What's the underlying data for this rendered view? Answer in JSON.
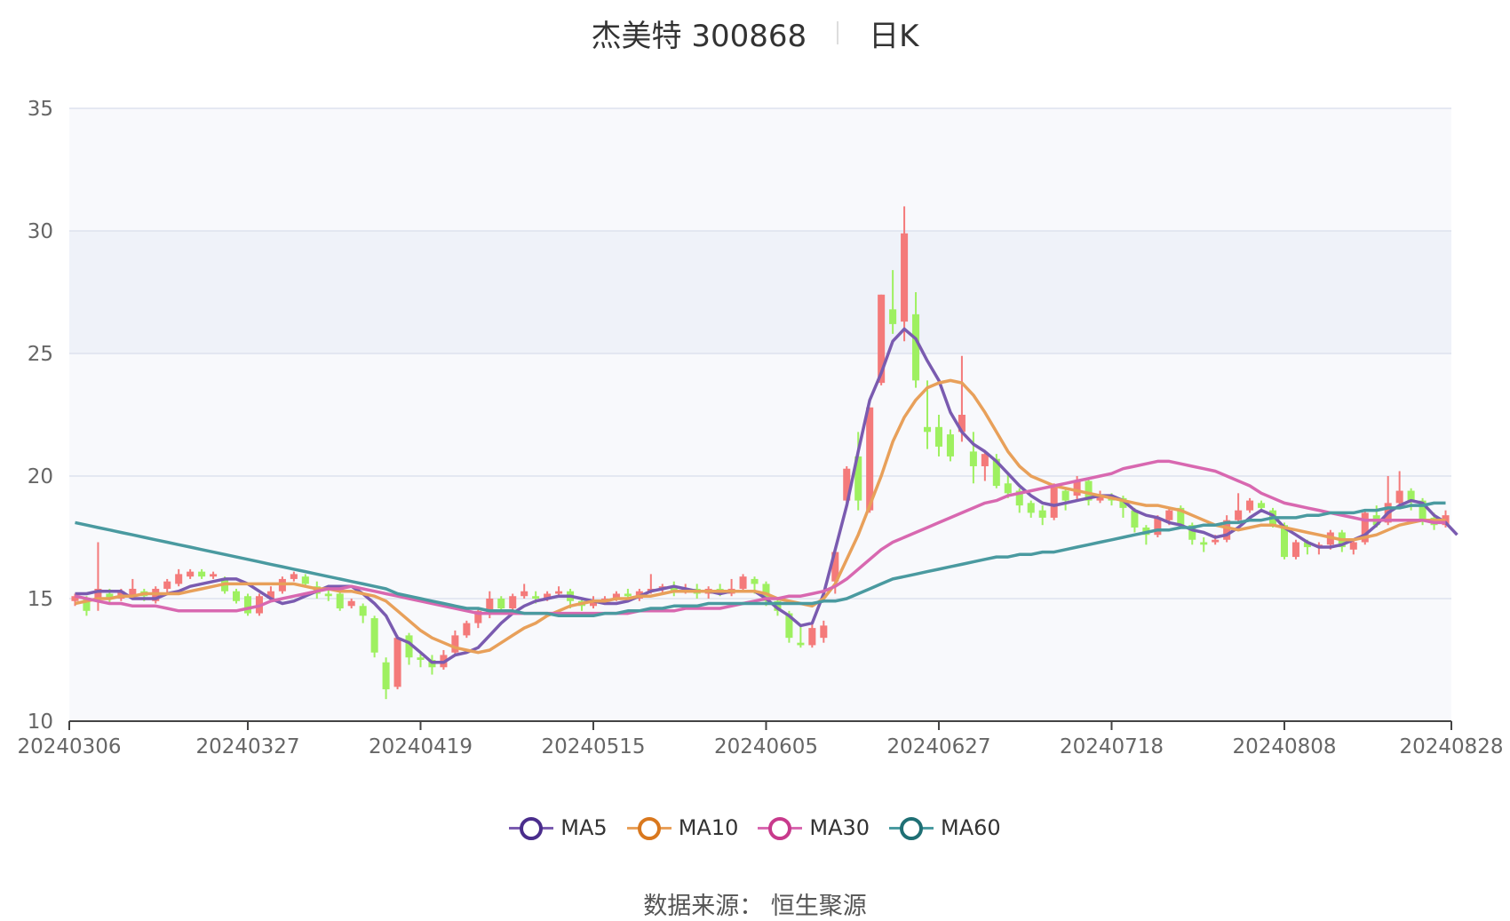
{
  "header": {
    "title": "杰美特 300868",
    "period": "日K"
  },
  "source": "数据来源： 恒生聚源",
  "colors": {
    "up": "#f47a7a",
    "down": "#9ef060",
    "MA5": "#7a5bb0",
    "MA10": "#e8a05a",
    "MA30": "#d868b0",
    "MA60": "#4a9aa0",
    "legend_ring": {
      "MA5": "#4a2d8c",
      "MA10": "#d9781e",
      "MA30": "#c83a8c",
      "MA60": "#1f6f74"
    }
  },
  "chart_data": {
    "type": "candlestick",
    "title": "杰美特 300868",
    "subtitle": "日K",
    "ylim": [
      10,
      35
    ],
    "y_ticks": [
      10,
      15,
      20,
      25,
      30,
      35
    ],
    "x_tick_labels": [
      "20240306",
      "20240327",
      "20240419",
      "20240515",
      "20240605",
      "20240627",
      "20240718",
      "20240808",
      "20240828"
    ],
    "x_tick_index": [
      0,
      15,
      30,
      45,
      60,
      75,
      90,
      105,
      119
    ],
    "grid": true,
    "legend_position": "bottom",
    "legend": [
      "MA5",
      "MA10",
      "MA30",
      "MA60"
    ],
    "candles": [
      [
        14.9,
        15.1,
        15.2,
        14.7
      ],
      [
        15.0,
        14.5,
        15.1,
        14.3
      ],
      [
        15.0,
        15.4,
        17.3,
        14.5
      ],
      [
        15.2,
        15.0,
        15.4,
        14.8
      ],
      [
        15.0,
        15.3,
        15.4,
        14.9
      ],
      [
        15.1,
        15.4,
        15.8,
        15.0
      ],
      [
        15.3,
        15.1,
        15.4,
        14.9
      ],
      [
        14.9,
        15.4,
        15.5,
        14.8
      ],
      [
        15.4,
        15.7,
        15.8,
        15.2
      ],
      [
        15.6,
        16.0,
        16.2,
        15.5
      ],
      [
        15.9,
        16.1,
        16.2,
        15.8
      ],
      [
        16.1,
        15.9,
        16.2,
        15.8
      ],
      [
        15.9,
        16.0,
        16.1,
        15.8
      ],
      [
        15.8,
        15.3,
        15.9,
        15.2
      ],
      [
        15.3,
        14.9,
        15.4,
        14.8
      ],
      [
        15.1,
        14.4,
        15.2,
        14.3
      ],
      [
        14.4,
        15.1,
        15.2,
        14.3
      ],
      [
        15.0,
        15.3,
        15.5,
        14.9
      ],
      [
        15.3,
        15.8,
        15.9,
        15.2
      ],
      [
        15.8,
        16.0,
        16.1,
        15.7
      ],
      [
        15.9,
        15.6,
        16.0,
        15.5
      ],
      [
        15.5,
        15.2,
        15.7,
        15.0
      ],
      [
        15.2,
        15.1,
        15.4,
        14.9
      ],
      [
        15.2,
        14.6,
        15.3,
        14.5
      ],
      [
        14.7,
        14.9,
        15.0,
        14.6
      ],
      [
        14.7,
        14.3,
        14.8,
        14.0
      ],
      [
        14.2,
        12.8,
        14.3,
        12.6
      ],
      [
        12.4,
        11.3,
        12.6,
        10.9
      ],
      [
        11.4,
        13.4,
        13.5,
        11.3
      ],
      [
        13.5,
        12.6,
        13.6,
        12.3
      ],
      [
        12.6,
        12.5,
        12.8,
        12.2
      ],
      [
        12.5,
        12.2,
        12.7,
        11.9
      ],
      [
        12.2,
        12.7,
        12.9,
        12.1
      ],
      [
        12.8,
        13.5,
        13.7,
        12.7
      ],
      [
        13.5,
        14.0,
        14.1,
        13.4
      ],
      [
        14.0,
        14.5,
        14.6,
        13.8
      ],
      [
        14.4,
        15.0,
        15.3,
        14.2
      ],
      [
        15.0,
        14.6,
        15.1,
        14.4
      ],
      [
        14.6,
        15.1,
        15.2,
        14.5
      ],
      [
        15.1,
        15.3,
        15.6,
        15.0
      ],
      [
        15.1,
        15.0,
        15.3,
        14.8
      ],
      [
        15.0,
        15.2,
        15.3,
        14.9
      ],
      [
        15.2,
        15.3,
        15.5,
        15.1
      ],
      [
        15.3,
        14.9,
        15.4,
        14.6
      ],
      [
        14.9,
        14.7,
        15.0,
        14.5
      ],
      [
        14.7,
        14.9,
        15.1,
        14.6
      ],
      [
        14.9,
        15.0,
        15.1,
        14.8
      ],
      [
        15.0,
        15.2,
        15.3,
        14.9
      ],
      [
        15.2,
        15.1,
        15.4,
        15.0
      ],
      [
        15.0,
        15.3,
        15.4,
        14.9
      ],
      [
        15.3,
        15.4,
        16.0,
        15.2
      ],
      [
        15.4,
        15.5,
        15.6,
        15.2
      ],
      [
        15.5,
        15.3,
        15.7,
        15.1
      ],
      [
        15.3,
        15.4,
        15.6,
        15.2
      ],
      [
        15.4,
        15.2,
        15.6,
        15.0
      ],
      [
        15.2,
        15.4,
        15.5,
        15.0
      ],
      [
        15.4,
        15.2,
        15.6,
        15.1
      ],
      [
        15.2,
        15.4,
        15.8,
        15.1
      ],
      [
        15.4,
        15.9,
        16.0,
        15.3
      ],
      [
        15.8,
        15.6,
        15.9,
        15.2
      ],
      [
        15.6,
        14.9,
        15.7,
        14.7
      ],
      [
        14.9,
        14.5,
        15.0,
        14.3
      ],
      [
        14.4,
        13.4,
        14.5,
        13.2
      ],
      [
        13.2,
        13.1,
        13.9,
        13.0
      ],
      [
        13.1,
        13.8,
        14.0,
        13.0
      ],
      [
        13.4,
        13.9,
        14.1,
        13.2
      ],
      [
        15.7,
        16.9,
        17.0,
        15.2
      ],
      [
        19.0,
        20.3,
        20.4,
        18.9
      ],
      [
        20.8,
        19.0,
        21.8,
        18.6
      ],
      [
        18.6,
        22.8,
        22.8,
        18.5
      ],
      [
        23.8,
        27.4,
        27.4,
        23.7
      ],
      [
        26.8,
        26.2,
        28.4,
        25.8
      ],
      [
        26.3,
        29.9,
        31.0,
        25.5
      ],
      [
        26.6,
        23.9,
        27.5,
        23.6
      ],
      [
        22.0,
        21.8,
        23.9,
        21.1
      ],
      [
        22.0,
        21.2,
        22.5,
        20.8
      ],
      [
        21.7,
        20.8,
        21.9,
        20.6
      ],
      [
        21.8,
        22.5,
        24.9,
        21.4
      ],
      [
        21.0,
        20.4,
        21.8,
        19.7
      ],
      [
        20.4,
        20.9,
        21.0,
        19.8
      ],
      [
        20.7,
        19.6,
        20.9,
        19.5
      ],
      [
        19.7,
        19.3,
        20.1,
        19.1
      ],
      [
        19.4,
        18.8,
        19.5,
        18.5
      ],
      [
        18.9,
        18.5,
        19.0,
        18.3
      ],
      [
        18.6,
        18.3,
        18.8,
        18.0
      ],
      [
        18.3,
        19.6,
        19.7,
        18.2
      ],
      [
        19.4,
        19.0,
        19.5,
        18.6
      ],
      [
        19.2,
        19.8,
        20.0,
        19.0
      ],
      [
        19.8,
        19.0,
        19.9,
        18.8
      ],
      [
        19.0,
        19.2,
        19.4,
        18.9
      ],
      [
        19.1,
        19.0,
        19.3,
        18.8
      ],
      [
        19.1,
        18.7,
        19.2,
        18.3
      ],
      [
        18.6,
        17.9,
        18.7,
        17.7
      ],
      [
        17.9,
        17.6,
        18.0,
        17.2
      ],
      [
        17.6,
        18.3,
        18.4,
        17.5
      ],
      [
        18.2,
        18.6,
        18.7,
        18.0
      ],
      [
        18.7,
        18.0,
        18.8,
        17.9
      ],
      [
        18.0,
        17.4,
        18.1,
        17.2
      ],
      [
        17.3,
        17.2,
        17.5,
        16.9
      ],
      [
        17.3,
        17.4,
        17.6,
        17.2
      ],
      [
        17.4,
        18.2,
        18.4,
        17.3
      ],
      [
        18.2,
        18.6,
        19.3,
        18.1
      ],
      [
        18.6,
        19.0,
        19.1,
        18.5
      ],
      [
        18.9,
        18.7,
        19.0,
        18.6
      ],
      [
        18.6,
        18.0,
        18.7,
        17.9
      ],
      [
        18.0,
        16.7,
        18.1,
        16.6
      ],
      [
        16.7,
        17.3,
        17.4,
        16.6
      ],
      [
        17.3,
        17.1,
        17.4,
        16.8
      ],
      [
        17.1,
        17.2,
        17.3,
        16.8
      ],
      [
        17.2,
        17.7,
        17.8,
        17.0
      ],
      [
        17.7,
        17.1,
        17.8,
        16.9
      ],
      [
        17.0,
        17.3,
        17.4,
        16.8
      ],
      [
        17.3,
        18.5,
        18.6,
        17.2
      ],
      [
        18.4,
        18.0,
        18.8,
        17.9
      ],
      [
        18.1,
        18.9,
        20.0,
        18.0
      ],
      [
        18.9,
        19.4,
        20.2,
        18.8
      ],
      [
        19.4,
        19.0,
        19.5,
        18.6
      ],
      [
        19.0,
        18.2,
        19.1,
        18.0
      ],
      [
        18.3,
        18.0,
        18.5,
        17.8
      ],
      [
        18.0,
        18.4,
        18.6,
        17.9
      ]
    ],
    "series": [
      {
        "name": "MA5",
        "values": [
          15.2,
          15.2,
          15.3,
          15.3,
          15.3,
          15.0,
          15.0,
          15.0,
          15.2,
          15.3,
          15.5,
          15.6,
          15.7,
          15.8,
          15.8,
          15.6,
          15.3,
          15.0,
          14.8,
          14.9,
          15.1,
          15.3,
          15.5,
          15.5,
          15.5,
          15.2,
          14.8,
          14.3,
          13.4,
          13.2,
          12.8,
          12.4,
          12.4,
          12.7,
          12.8,
          13.0,
          13.5,
          14.0,
          14.4,
          14.7,
          14.9,
          15.0,
          15.1,
          15.1,
          15.0,
          14.9,
          14.8,
          14.8,
          14.9,
          15.1,
          15.3,
          15.4,
          15.5,
          15.4,
          15.3,
          15.3,
          15.2,
          15.3,
          15.3,
          15.3,
          15.0,
          14.6,
          14.3,
          13.9,
          14.0,
          15.2,
          17.0,
          18.8,
          21.0,
          23.1,
          24.2,
          25.5,
          26.0,
          25.6,
          24.7,
          23.9,
          22.6,
          21.8,
          21.3,
          21.0,
          20.6,
          20.1,
          19.6,
          19.2,
          18.9,
          18.8,
          18.9,
          19.0,
          19.1,
          19.2,
          19.2,
          19.0,
          18.6,
          18.4,
          18.3,
          18.1,
          18.0,
          17.8,
          17.7,
          17.5,
          17.6,
          17.9,
          18.3,
          18.6,
          18.4,
          17.9,
          17.6,
          17.3,
          17.1,
          17.1,
          17.2,
          17.4,
          17.6,
          18.0,
          18.5,
          18.8,
          19.0,
          18.9,
          18.4,
          18.1,
          17.6
        ]
      },
      {
        "name": "MA10",
        "values": [
          14.8,
          14.9,
          15.0,
          15.0,
          15.1,
          15.1,
          15.2,
          15.2,
          15.2,
          15.2,
          15.3,
          15.4,
          15.5,
          15.6,
          15.6,
          15.6,
          15.6,
          15.6,
          15.6,
          15.6,
          15.5,
          15.4,
          15.4,
          15.3,
          15.3,
          15.2,
          15.1,
          14.9,
          14.5,
          14.1,
          13.7,
          13.4,
          13.2,
          13.0,
          12.9,
          12.8,
          12.9,
          13.2,
          13.5,
          13.8,
          14.0,
          14.3,
          14.5,
          14.7,
          14.8,
          14.9,
          14.9,
          15.0,
          15.0,
          15.1,
          15.1,
          15.2,
          15.3,
          15.3,
          15.3,
          15.3,
          15.3,
          15.3,
          15.3,
          15.3,
          15.2,
          15.0,
          14.9,
          14.8,
          14.7,
          15.0,
          15.6,
          16.6,
          17.6,
          18.8,
          20.0,
          21.4,
          22.4,
          23.1,
          23.6,
          23.8,
          23.9,
          23.8,
          23.3,
          22.6,
          21.8,
          21.0,
          20.4,
          20.0,
          19.8,
          19.6,
          19.5,
          19.4,
          19.3,
          19.2,
          19.1,
          19.0,
          18.9,
          18.8,
          18.8,
          18.7,
          18.6,
          18.4,
          18.2,
          18.0,
          17.9,
          17.8,
          17.9,
          18.0,
          18.0,
          17.9,
          17.8,
          17.7,
          17.6,
          17.5,
          17.4,
          17.4,
          17.5,
          17.6,
          17.8,
          18.0,
          18.1,
          18.2,
          18.2,
          18.2
        ]
      },
      {
        "name": "MA30",
        "values": [
          15.1,
          15.0,
          14.9,
          14.8,
          14.8,
          14.7,
          14.7,
          14.7,
          14.6,
          14.5,
          14.5,
          14.5,
          14.5,
          14.5,
          14.5,
          14.6,
          14.7,
          14.9,
          15.0,
          15.1,
          15.2,
          15.3,
          15.4,
          15.4,
          15.5,
          15.4,
          15.3,
          15.2,
          15.1,
          15.0,
          14.9,
          14.8,
          14.7,
          14.6,
          14.5,
          14.4,
          14.4,
          14.4,
          14.4,
          14.4,
          14.4,
          14.4,
          14.4,
          14.4,
          14.4,
          14.4,
          14.4,
          14.4,
          14.4,
          14.5,
          14.5,
          14.5,
          14.5,
          14.6,
          14.6,
          14.6,
          14.6,
          14.7,
          14.8,
          14.9,
          15.0,
          15.0,
          15.1,
          15.1,
          15.2,
          15.3,
          15.5,
          15.8,
          16.2,
          16.6,
          17.0,
          17.3,
          17.5,
          17.7,
          17.9,
          18.1,
          18.3,
          18.5,
          18.7,
          18.9,
          19.0,
          19.2,
          19.3,
          19.4,
          19.5,
          19.6,
          19.7,
          19.8,
          19.9,
          20.0,
          20.1,
          20.3,
          20.4,
          20.5,
          20.6,
          20.6,
          20.5,
          20.4,
          20.3,
          20.2,
          20.0,
          19.8,
          19.6,
          19.3,
          19.1,
          18.9,
          18.8,
          18.7,
          18.6,
          18.5,
          18.4,
          18.3,
          18.2,
          18.2,
          18.2,
          18.2,
          18.2,
          18.2,
          18.1,
          18.1
        ]
      },
      {
        "name": "MA60",
        "values": [
          18.1,
          18.0,
          17.9,
          17.8,
          17.7,
          17.6,
          17.5,
          17.4,
          17.3,
          17.2,
          17.1,
          17.0,
          16.9,
          16.8,
          16.7,
          16.6,
          16.5,
          16.4,
          16.3,
          16.2,
          16.1,
          16.0,
          15.9,
          15.8,
          15.7,
          15.6,
          15.5,
          15.4,
          15.2,
          15.1,
          15.0,
          14.9,
          14.8,
          14.7,
          14.6,
          14.6,
          14.5,
          14.5,
          14.5,
          14.4,
          14.4,
          14.4,
          14.3,
          14.3,
          14.3,
          14.3,
          14.4,
          14.4,
          14.5,
          14.5,
          14.6,
          14.6,
          14.7,
          14.7,
          14.7,
          14.8,
          14.8,
          14.8,
          14.8,
          14.8,
          14.8,
          14.8,
          14.8,
          14.8,
          14.8,
          14.9,
          14.9,
          15.0,
          15.2,
          15.4,
          15.6,
          15.8,
          15.9,
          16.0,
          16.1,
          16.2,
          16.3,
          16.4,
          16.5,
          16.6,
          16.7,
          16.7,
          16.8,
          16.8,
          16.9,
          16.9,
          17.0,
          17.1,
          17.2,
          17.3,
          17.4,
          17.5,
          17.6,
          17.7,
          17.8,
          17.8,
          17.9,
          17.9,
          18.0,
          18.0,
          18.1,
          18.1,
          18.2,
          18.2,
          18.3,
          18.3,
          18.3,
          18.4,
          18.4,
          18.5,
          18.5,
          18.5,
          18.6,
          18.6,
          18.7,
          18.7,
          18.8,
          18.8,
          18.9,
          18.9
        ]
      }
    ]
  }
}
